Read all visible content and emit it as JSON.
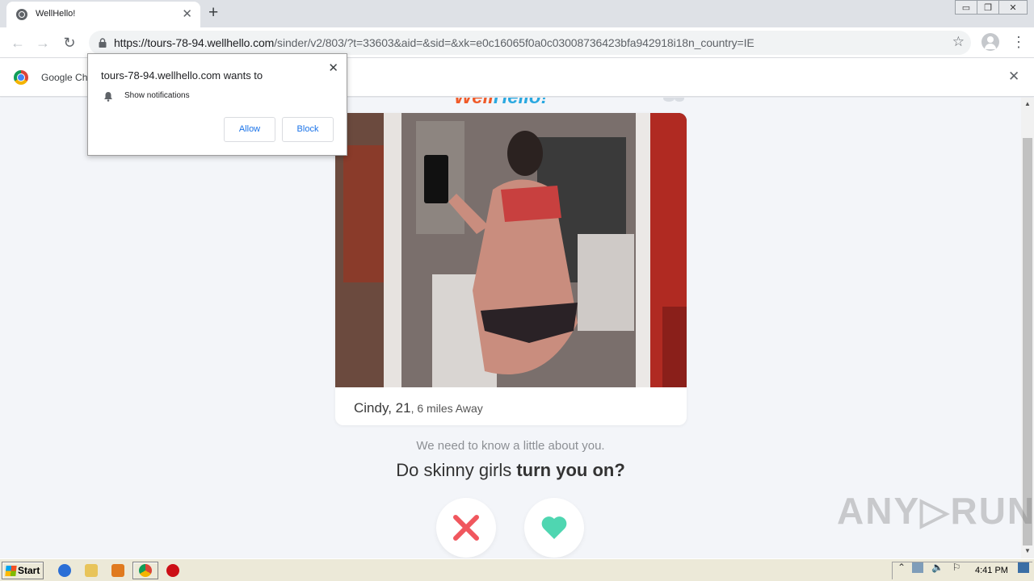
{
  "browser": {
    "tab_title": "WellHello!",
    "tab_close": "✕",
    "new_tab": "+",
    "url_host": "https://tours-78-94.wellhello.com",
    "url_path": "/sinder/v2/803/?t=33603&aid=&sid=&xk=e0c16065f0a0c03008736423bfa942918i18n_country=IE",
    "window_controls": [
      "▭",
      "❐",
      "✕"
    ],
    "back": "←",
    "forward": "→",
    "reload": "↻",
    "bookmark_star": "☆",
    "menu": "⋮"
  },
  "infobar": {
    "text": "Google Ch",
    "close": "✕"
  },
  "popup": {
    "title": "tours-78-94.wellhello.com wants to",
    "permission": "Show notifications",
    "allow": "Allow",
    "block": "Block",
    "close": "✕"
  },
  "page": {
    "logo_part1": "Well",
    "logo_part2": "Hello",
    "logo_punct": "!",
    "profile_name_age": "Cindy, 21",
    "profile_distance": ", 6 miles Away",
    "question_sub": "We need to know a little about you.",
    "question_plain": "Do skinny girls ",
    "question_bold": "turn you on?",
    "colors": {
      "nope": "#f0575e",
      "like": "#4fd6b1",
      "logo_orange": "#f05a28",
      "logo_blue": "#29a8e0"
    }
  },
  "watermark": "ANY▷RUN",
  "taskbar": {
    "start_label": "Start",
    "clock": "4:41 PM",
    "icons": [
      "ie-icon",
      "folder-icon",
      "media-player-icon",
      "chrome-icon",
      "opera-icon"
    ]
  }
}
